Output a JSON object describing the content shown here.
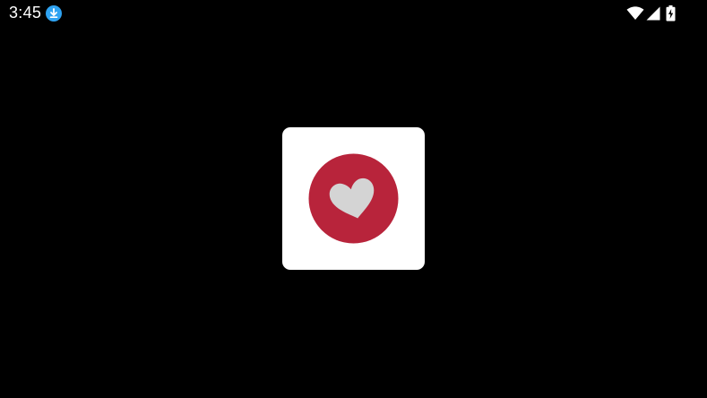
{
  "status_bar": {
    "time": "3:45",
    "notification_icon": "download-icon",
    "signal_icons": [
      "wifi-icon",
      "cellular-signal-icon",
      "battery-charging-icon"
    ]
  },
  "splash": {
    "logo_icon": "heart-logo-icon",
    "colors": {
      "background": "#000000",
      "card": "#ffffff",
      "circle": "#b8243b",
      "heart": "#d4d4d4",
      "download_badge": "#2fa3f2"
    }
  }
}
